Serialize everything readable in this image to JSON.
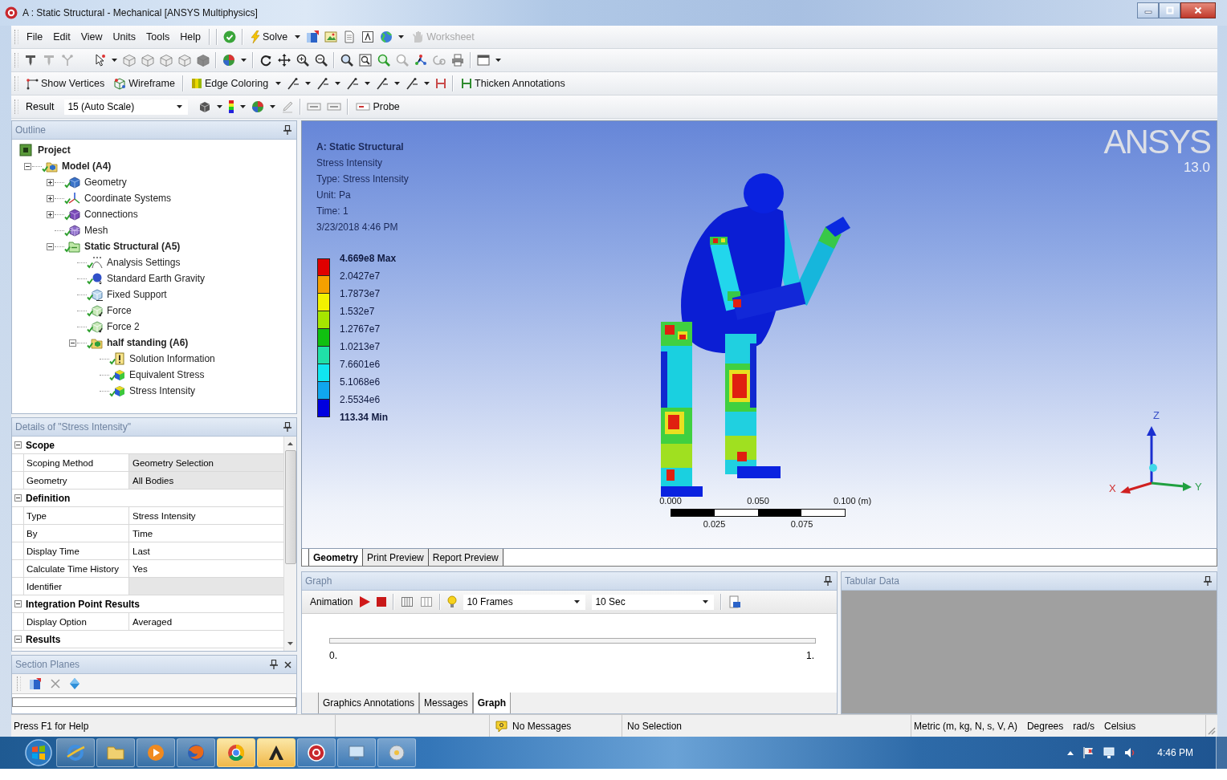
{
  "window": {
    "title": "A : Static Structural - Mechanical [ANSYS Multiphysics]"
  },
  "menu_bar": [
    "File",
    "Edit",
    "View",
    "Units",
    "Tools",
    "Help"
  ],
  "toolbar": {
    "solve": "Solve",
    "worksheet": {
      "label": "Worksheet",
      "disabled": true
    },
    "show_vertices": "Show Vertices",
    "wireframe": "Wireframe",
    "edge_coloring": "Edge Coloring",
    "thicken_annotations": "Thicken Annotations",
    "result_label": "Result",
    "result_scale": "15 (Auto Scale)",
    "probe": "Probe"
  },
  "outline": {
    "title": "Outline",
    "tree": [
      {
        "label": "Project",
        "kind": "project",
        "children": [
          {
            "label": "Model (A4)",
            "kind": "model",
            "expanded": true,
            "children": [
              {
                "label": "Geometry",
                "kind": "geometry",
                "expanded": false
              },
              {
                "label": "Coordinate Systems",
                "kind": "coordinates",
                "expanded": false
              },
              {
                "label": "Connections",
                "kind": "connections",
                "expanded": false
              },
              {
                "label": "Mesh",
                "kind": "mesh"
              },
              {
                "label": "Static Structural (A5)",
                "kind": "analysis",
                "expanded": true,
                "children": [
                  {
                    "label": "Analysis Settings",
                    "kind": "settings"
                  },
                  {
                    "label": "Standard Earth Gravity",
                    "kind": "gravity"
                  },
                  {
                    "label": "Fixed Support",
                    "kind": "support"
                  },
                  {
                    "label": "Force",
                    "kind": "force"
                  },
                  {
                    "label": "Force 2",
                    "kind": "force"
                  },
                  {
                    "label": "half standing (A6)",
                    "kind": "solution",
                    "expanded": true,
                    "children": [
                      {
                        "label": "Solution Information",
                        "kind": "info"
                      },
                      {
                        "label": "Equivalent Stress",
                        "kind": "result"
                      },
                      {
                        "label": "Stress Intensity",
                        "kind": "result"
                      }
                    ]
                  }
                ]
              }
            ]
          }
        ]
      }
    ]
  },
  "details": {
    "title": "Details of \"Stress Intensity\"",
    "sections": [
      {
        "name": "Scope",
        "expanded": true,
        "rows": [
          {
            "label": "Scoping Method",
            "value": "Geometry Selection",
            "readonly": true
          },
          {
            "label": "Geometry",
            "value": "All Bodies",
            "readonly": true
          }
        ]
      },
      {
        "name": "Definition",
        "expanded": true,
        "rows": [
          {
            "label": "Type",
            "value": "Stress Intensity",
            "readonly": false
          },
          {
            "label": "By",
            "value": "Time",
            "readonly": false
          },
          {
            "label": "Display Time",
            "value": "Last",
            "readonly": false
          },
          {
            "label": "Calculate Time History",
            "value": "Yes",
            "readonly": false
          },
          {
            "label": "Identifier",
            "readonly": true
          }
        ]
      },
      {
        "name": "Integration Point Results",
        "expanded": true,
        "rows": [
          {
            "label": "Display Option",
            "value": "Averaged",
            "readonly": false
          }
        ]
      },
      {
        "name": "Results",
        "expanded": true
      }
    ]
  },
  "section_planes": {
    "title": "Section Planes"
  },
  "viewport": {
    "annotation": {
      "title": "A: Static Structural",
      "lines": [
        "Stress Intensity",
        "Type: Stress Intensity",
        "Unit: Pa",
        "Time: 1",
        "3/23/2018 4:46 PM"
      ]
    },
    "legend": {
      "labels": [
        "4.669e8 Max",
        "2.0427e7",
        "1.7873e7",
        "1.532e7",
        "1.2767e7",
        "1.0213e7",
        "7.6601e6",
        "5.1068e6",
        "2.5534e6",
        "113.34 Min"
      ],
      "bands": [
        {
          "color": "#e00000"
        },
        {
          "color": "#f5a000"
        },
        {
          "color": "#f2f200"
        },
        {
          "color": "#a6e600"
        },
        {
          "color": "#10c010"
        },
        {
          "color": "#20e0a8"
        },
        {
          "color": "#10e6f0"
        },
        {
          "color": "#10a6ee"
        },
        {
          "color": "#0000e0"
        }
      ]
    },
    "logo": {
      "name": "ANSYS",
      "version": "13.0"
    },
    "scale_ruler": {
      "top_labels": [
        "0.000",
        "0.050",
        "0.100 (m)"
      ],
      "bottom_labels": [
        "0.025",
        "0.075"
      ]
    },
    "axis_triad": {
      "z": "Z",
      "x": "X",
      "y": "Y"
    }
  },
  "view_tabs": [
    {
      "label": "Geometry",
      "selected": true
    },
    {
      "label": "Print Preview",
      "selected": false
    },
    {
      "label": "Report Preview",
      "selected": false
    }
  ],
  "graph": {
    "title": "Graph",
    "animation_label": "Animation",
    "frames": "10 Frames",
    "duration": "10 Sec",
    "axis_start": "0.",
    "axis_end": "1."
  },
  "bottom_tabs": [
    {
      "label": "Graphics Annotations",
      "selected": false
    },
    {
      "label": "Messages",
      "selected": false
    },
    {
      "label": "Graph",
      "selected": true
    }
  ],
  "tabular_data": {
    "title": "Tabular Data"
  },
  "status_bar": {
    "help": "Press F1 for Help",
    "messages": "No Messages",
    "selection": "No Selection",
    "units": "Metric (m, kg, N, s, V, A)",
    "angle": "Degrees",
    "rotational_velocity": "rad/s",
    "temperature": "Celsius"
  },
  "taskbar": {
    "apps": [
      {
        "kind": "ring",
        "highlighted": false
      },
      {
        "kind": "folder",
        "highlighted": false
      },
      {
        "kind": "media",
        "highlighted": false
      },
      {
        "kind": "fox",
        "highlighted": false
      },
      {
        "kind": "wheel",
        "highlighted": true
      },
      {
        "kind": "chevron",
        "highlighted": true
      },
      {
        "kind": "round",
        "highlighted": false
      },
      {
        "kind": "monitor",
        "highlighted": false
      },
      {
        "kind": "disc",
        "highlighted": false
      }
    ],
    "clock": "4:46 PM"
  }
}
